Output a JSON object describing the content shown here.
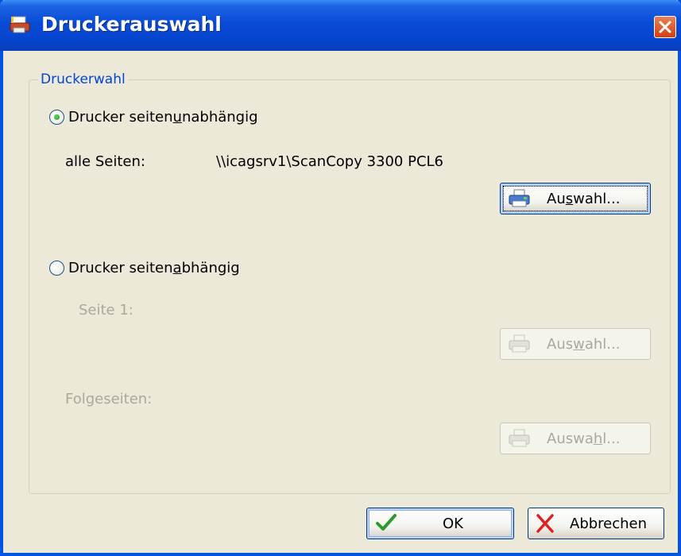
{
  "window": {
    "title": "Druckerauswahl"
  },
  "group": {
    "label": "Druckerwahl"
  },
  "option_independent": {
    "label_pre": "Drucker seiten",
    "label_u": "u",
    "label_post": "nabhängig",
    "selected": true
  },
  "all_pages": {
    "label": "alle Seiten:",
    "value": "\\\\icagsrv1\\ScanCopy 3300 PCL6"
  },
  "select_button_1": {
    "label_pre": "Au",
    "label_u": "s",
    "label_post": "wahl..."
  },
  "option_dependent": {
    "label_pre": "Drucker seiten",
    "label_u": "a",
    "label_post": "bhängig",
    "selected": false
  },
  "page1": {
    "label": "Seite 1:"
  },
  "select_button_2": {
    "label_pre": "Aus",
    "label_u": "w",
    "label_post": "ahl..."
  },
  "following_pages": {
    "label": "Folgeseiten:"
  },
  "select_button_3": {
    "label_pre": "Auswa",
    "label_u": "h",
    "label_post": "l..."
  },
  "ok_button": {
    "label": "OK"
  },
  "cancel_button": {
    "label": "Abbrechen"
  },
  "colors": {
    "title_bar": "#0A4BD6",
    "dialog_bg": "#ECE9D8",
    "group_label": "#0046D5",
    "disabled_text": "#ACA899",
    "close_button": "#D23F10"
  },
  "icons": {
    "title": "printer-app-icon",
    "close": "close-icon",
    "select": "printer-icon",
    "ok": "checkmark-icon",
    "cancel": "cross-icon"
  }
}
